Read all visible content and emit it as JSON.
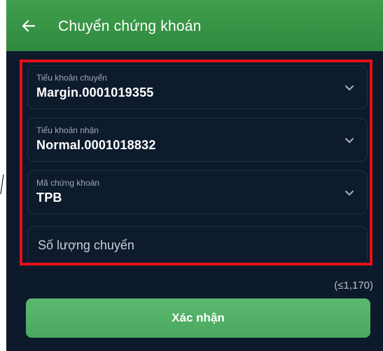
{
  "header": {
    "back_icon": "arrow-left-icon",
    "title": "Chuyển chứng khoán",
    "background": "#3a9a48"
  },
  "form": {
    "source_account": {
      "label": "Tiểu khoản chuyển",
      "value": "Margin.0001019355",
      "icon": "chevron-down-icon"
    },
    "target_account": {
      "label": "Tiểu khoản nhận",
      "value": "Normal.0001018832",
      "icon": "chevron-down-icon"
    },
    "stock_code": {
      "label": "Mã chứng khoán",
      "value": "TPB",
      "icon": "chevron-down-icon"
    },
    "quantity": {
      "placeholder": "Số lượng chuyển",
      "value": ""
    },
    "limit_text": "(≤1,170)"
  },
  "confirm_button": {
    "label": "Xác nhận",
    "color": "#52b066"
  },
  "highlight": {
    "color": "#e6101a"
  }
}
